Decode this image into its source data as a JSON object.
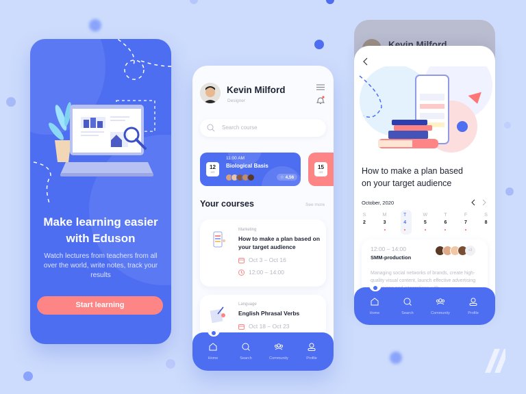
{
  "onboarding": {
    "headline_line1": "Make learning easier",
    "headline_line2": "with Eduson",
    "description": "Watch lectures from teachers from all over the world, write notes, track your results",
    "cta_label": "Start learning"
  },
  "home": {
    "user": {
      "name": "Kevin Milford",
      "role": "Designer"
    },
    "search_placeholder": "Search course",
    "events": [
      {
        "day": "12",
        "month": "oct",
        "time": "11:00 AM",
        "title": "Biological Basis",
        "rating": "4,56"
      },
      {
        "day": "15",
        "month": "oct"
      }
    ],
    "courses_title": "Your courses",
    "see_more": "See more",
    "courses": [
      {
        "category": "Marketing",
        "title": "How to make a plan based on your target audience",
        "dates": "Oct 3 – Oct 16",
        "time": "12:00 – 14:00"
      },
      {
        "category": "Language",
        "title": "English Phrasal Verbs",
        "dates": "Oct 18 – Oct 23"
      }
    ]
  },
  "nav": {
    "items": [
      "Home",
      "Search",
      "Community",
      "Profile"
    ]
  },
  "detail": {
    "behind_name": "Kevin Milford",
    "title_line1": "How to make a plan based",
    "title_line2": "on your target audience",
    "month": "October, 2020",
    "weekdays": [
      "S",
      "M",
      "T",
      "W",
      "T",
      "F",
      "S"
    ],
    "days": [
      "2",
      "3",
      "4",
      "5",
      "6",
      "7",
      "8"
    ],
    "selected_day": "4",
    "session": {
      "time": "12:00 – 14:00",
      "title": "SMM-production",
      "extra": "+3",
      "description": "Managing social networks of brands, create high-quality visual content, launch effective advertising campaigns and integrations with"
    }
  },
  "colors": {
    "primary": "#4e6ef2",
    "accent": "#fd8585",
    "background": "#cddcfc"
  }
}
